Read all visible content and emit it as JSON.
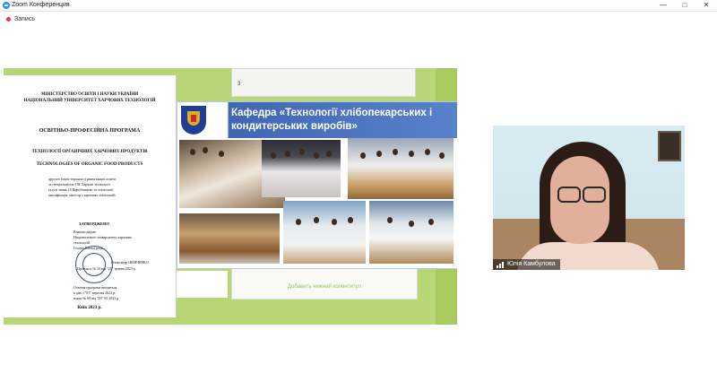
{
  "window": {
    "title": "Zoom Конференция",
    "controls": [
      "—",
      "□",
      "✕"
    ]
  },
  "toolbar": {
    "recording_label": "Запись"
  },
  "document": {
    "ministry": "МІНІСТЕРСТВО ОСВІТИ І НАУКИ УКРАЇНИ",
    "university": "НАЦІОНАЛЬНИЙ УНІВЕРСИТЕТ ХАРЧОВИХ ТЕХНОЛОГІЙ",
    "program_title": "ОСВІТНЬО-ПРОФЕСІЙНА ПРОГРАМА",
    "program_name_ua": "ТЕХНОЛОГІЇ ОРГАНІЧНИХ ХАРЧОВИХ ПРОДУКТІВ",
    "program_name_en": "TECHNOLOGIES OF ORGANIC FOOD PRODUCTS",
    "level_line1": "другого (магістерського) рівня вищої освіти",
    "level_line2": "за спеціальністю 181 Харчові технології",
    "level_line3": "галузі знань 18 Виробництво та технології",
    "level_line4": "кваліфікація: магістр з харчових технологій",
    "approved": "ЗАТВЕРДЖЕНО",
    "approved_line1": "Вченою радою",
    "approved_line2": "Національного університету харчових",
    "approved_line3": "технологій",
    "approved_line4": "Голова Вченої ради",
    "signer": "Олександр ШЕВЧЕНКО",
    "protocol": "Протокол № 10 від \"25\" травня 2023 р.",
    "enacted_line1": "Освітня програма вводиться",
    "enacted_line2": "в дію з \"01\" вересня 2023 р.",
    "enacted_line3": "наказ № 69 від \"26\" 05 2023 р.",
    "city_year": "Київ 2023 р."
  },
  "slides": {
    "top_slide_number": "3",
    "footer_placeholder": "Добавить нижний колонтитул"
  },
  "presentation": {
    "title": "Кафедра «Технології хлібопекарських і кондитерських виробів»"
  },
  "participant": {
    "name": "Юлія Камбулова",
    "icon": "signal-icon"
  },
  "colors": {
    "share_bg": "#b9d676",
    "slide_header": "#3f66b4",
    "recording_dot": "#e63b3b"
  }
}
